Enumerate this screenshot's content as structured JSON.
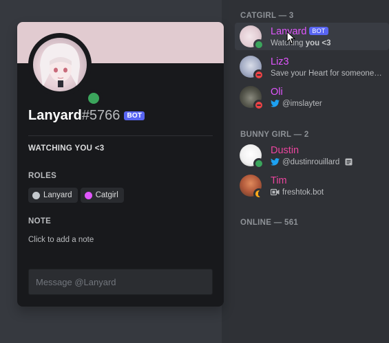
{
  "profile": {
    "username": "Lanyard",
    "discriminator": "#5766",
    "bot_tag": "BOT",
    "activity": "WATCHING YOU <3",
    "roles_title": "ROLES",
    "roles": [
      {
        "name": "Lanyard",
        "color": "#c4c9ce"
      },
      {
        "name": "Catgirl",
        "color": "#e056fd"
      }
    ],
    "note_title": "NOTE",
    "note_placeholder": "Click to add a note",
    "message_placeholder": "Message @Lanyard",
    "banner_color": "#e1cbd0",
    "status": "online"
  },
  "member_list": {
    "groups": [
      {
        "header": "CATGIRL — 3",
        "members": [
          {
            "name": "Lanyard",
            "bot_tag": "BOT",
            "activity_prefix": "Watching",
            "activity_bold": "you <3",
            "name_color": "#e056fd",
            "status": "online"
          },
          {
            "name": "Liz3",
            "activity": "Save your Heart for someone c...",
            "name_color": "#e056fd",
            "status": "dnd"
          },
          {
            "name": "Oli",
            "activity": "@imslayter",
            "activity_icon": "twitter-icon",
            "name_color": "#e056fd",
            "status": "dnd"
          }
        ]
      },
      {
        "header": "BUNNY GIRL — 2",
        "members": [
          {
            "name": "Dustin",
            "activity": "@dustinrouillard",
            "activity_icon": "twitter-icon",
            "extra_icon": "note-icon",
            "name_color": "#eb459e",
            "status": "online"
          },
          {
            "name": "Tim",
            "activity": "freshtok.bot",
            "activity_icon": "video-icon",
            "name_color": "#eb459e",
            "status": "idle"
          }
        ]
      },
      {
        "header": "ONLINE — 561",
        "members": []
      }
    ]
  },
  "colors": {
    "status_online": "#3ba55c",
    "status_dnd": "#ed4245",
    "status_idle": "#faa81a",
    "bot_tag": "#5865f2",
    "twitter": "#1da1f2"
  }
}
